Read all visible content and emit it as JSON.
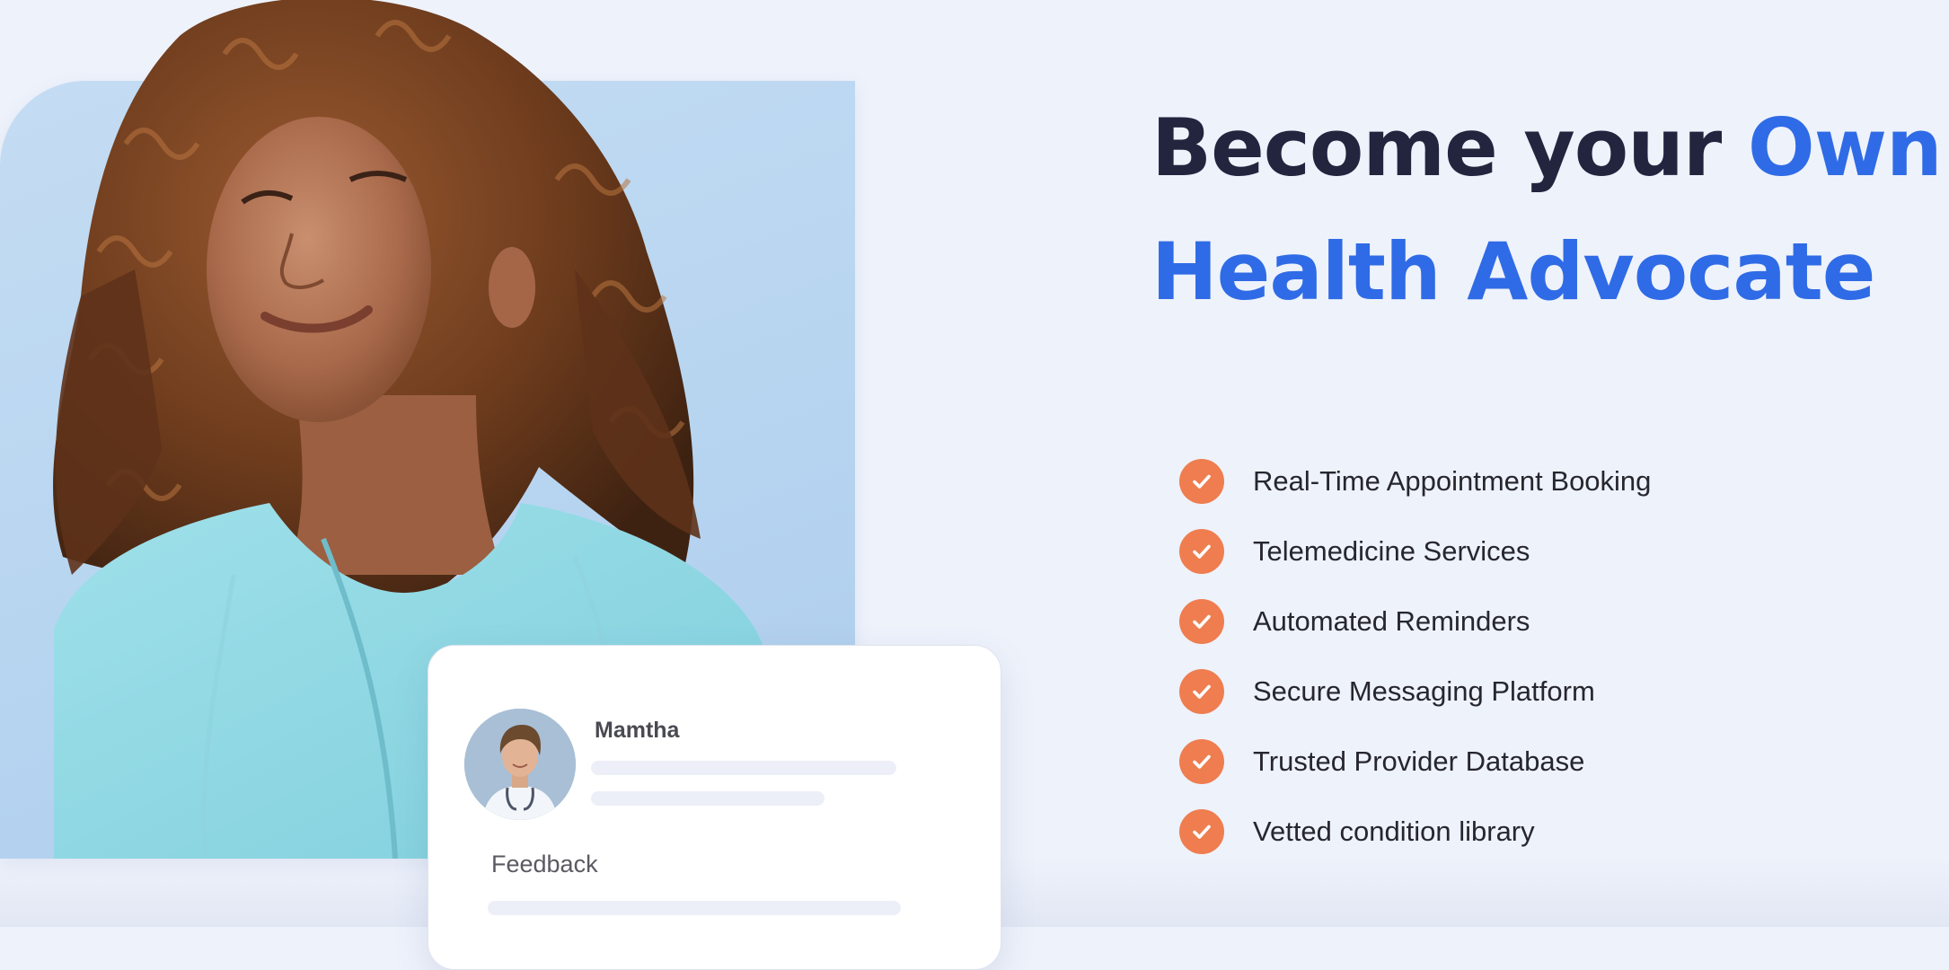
{
  "hero": {
    "headline_part1": "Become your ",
    "headline_part2": "Own",
    "headline_part3": "Health Advocate"
  },
  "features": [
    {
      "label": "Real-Time Appointment Booking",
      "icon": "check-circle-icon"
    },
    {
      "label": "Telemedicine Services",
      "icon": "check-circle-icon"
    },
    {
      "label": "Automated Reminders",
      "icon": "check-circle-icon"
    },
    {
      "label": "Secure Messaging Platform",
      "icon": "check-circle-icon"
    },
    {
      "label": "Trusted Provider Database",
      "icon": "check-circle-icon"
    },
    {
      "label": "Vetted condition library",
      "icon": "check-circle-icon"
    }
  ],
  "card": {
    "name": "Mamtha",
    "feedback_label": "Feedback"
  },
  "colors": {
    "background": "#eef2fb",
    "headline_dark": "#23253f",
    "headline_accent": "#2f6be6",
    "check_badge": "#ef7d4f",
    "photo_panel": "#b6d4f0"
  }
}
